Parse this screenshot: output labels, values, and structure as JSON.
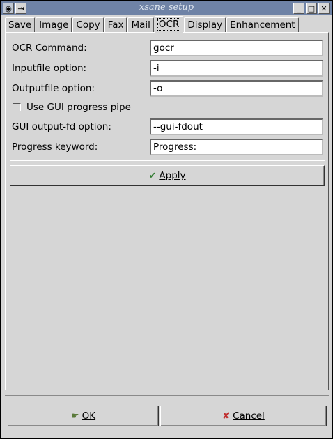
{
  "window": {
    "title": "xsane setup",
    "controls": {
      "menu_icon": "eye-icon",
      "pin_icon": "pin-icon",
      "minimize": "_",
      "maximize": "□",
      "close": "✕"
    }
  },
  "tabs": [
    {
      "label": "Save",
      "active": false
    },
    {
      "label": "Image",
      "active": false
    },
    {
      "label": "Copy",
      "active": false
    },
    {
      "label": "Fax",
      "active": false
    },
    {
      "label": "Mail",
      "active": false
    },
    {
      "label": "OCR",
      "active": true
    },
    {
      "label": "Display",
      "active": false
    },
    {
      "label": "Enhancement",
      "active": false
    }
  ],
  "ocr": {
    "command": {
      "label": "OCR Command:",
      "value": "gocr"
    },
    "inputfile": {
      "label": "Inputfile option:",
      "value": "-i"
    },
    "outputfile": {
      "label": "Outputfile option:",
      "value": "-o"
    },
    "progress_pipe": {
      "label": "Use GUI progress pipe",
      "checked": false
    },
    "gui_output_fd": {
      "label": "GUI output-fd option:",
      "value": "--gui-fdout"
    },
    "progress_keyword": {
      "label": "Progress keyword:",
      "value": "Progress:"
    },
    "apply_label": "Apply"
  },
  "footer": {
    "ok_label": "OK",
    "cancel_label": "Cancel"
  },
  "colors": {
    "titlebar": "#6f83a6",
    "background": "#d6d6d6",
    "apply_icon": "#2f7a2f",
    "cancel_icon": "#c03030"
  }
}
